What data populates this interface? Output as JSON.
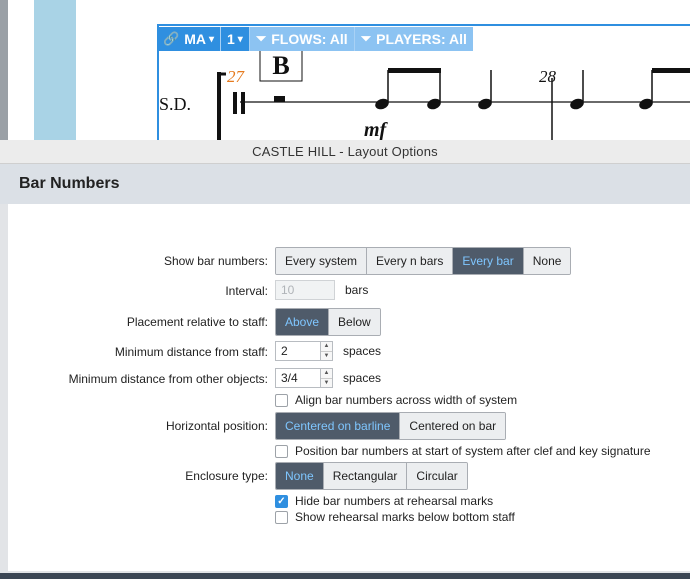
{
  "window": {
    "title": "CASTLE HILL - Layout Options"
  },
  "section": {
    "title": "Bar Numbers"
  },
  "score": {
    "toolbar": {
      "layout_name": "MA",
      "page_number": "1",
      "flows_label": "FLOWS: All",
      "players_label": "PLAYERS: All"
    },
    "rehearsal_mark": "B",
    "bar_number_current": "27",
    "bar_number_next": "28",
    "staff_label": "S.D.",
    "dynamic": "mf"
  },
  "options": {
    "show_bar_numbers": {
      "label": "Show bar numbers:",
      "options": [
        "Every system",
        "Every n bars",
        "Every bar",
        "None"
      ],
      "selected": "Every bar"
    },
    "interval": {
      "label": "Interval:",
      "value": "10",
      "unit": "bars"
    },
    "placement": {
      "label": "Placement relative to staff:",
      "options": [
        "Above",
        "Below"
      ],
      "selected": "Above"
    },
    "min_distance_staff": {
      "label": "Minimum distance from staff:",
      "value": "2",
      "unit": "spaces"
    },
    "min_distance_objects": {
      "label": "Minimum distance from other objects:",
      "value": "3/4",
      "unit": "spaces"
    },
    "align_across": {
      "label": "Align bar numbers across width of system",
      "checked": false
    },
    "horizontal_position": {
      "label": "Horizontal position:",
      "options": [
        "Centered on barline",
        "Centered on bar"
      ],
      "selected": "Centered on barline"
    },
    "position_start": {
      "label": "Position bar numbers at start of system after clef and key signature",
      "checked": false
    },
    "enclosure": {
      "label": "Enclosure type:",
      "options": [
        "None",
        "Rectangular",
        "Circular"
      ],
      "selected": "None"
    },
    "hide_at_rehearsal": {
      "label": "Hide bar numbers at rehearsal marks",
      "checked": true
    },
    "show_rehearsal_below": {
      "label": "Show rehearsal marks below bottom staff",
      "checked": false
    }
  },
  "colors": {
    "accent": "#2f8fe0",
    "selected_bg": "#4f5b6a",
    "selected_text": "#7fc6ff",
    "bar_number_orange": "#e57a1e"
  }
}
